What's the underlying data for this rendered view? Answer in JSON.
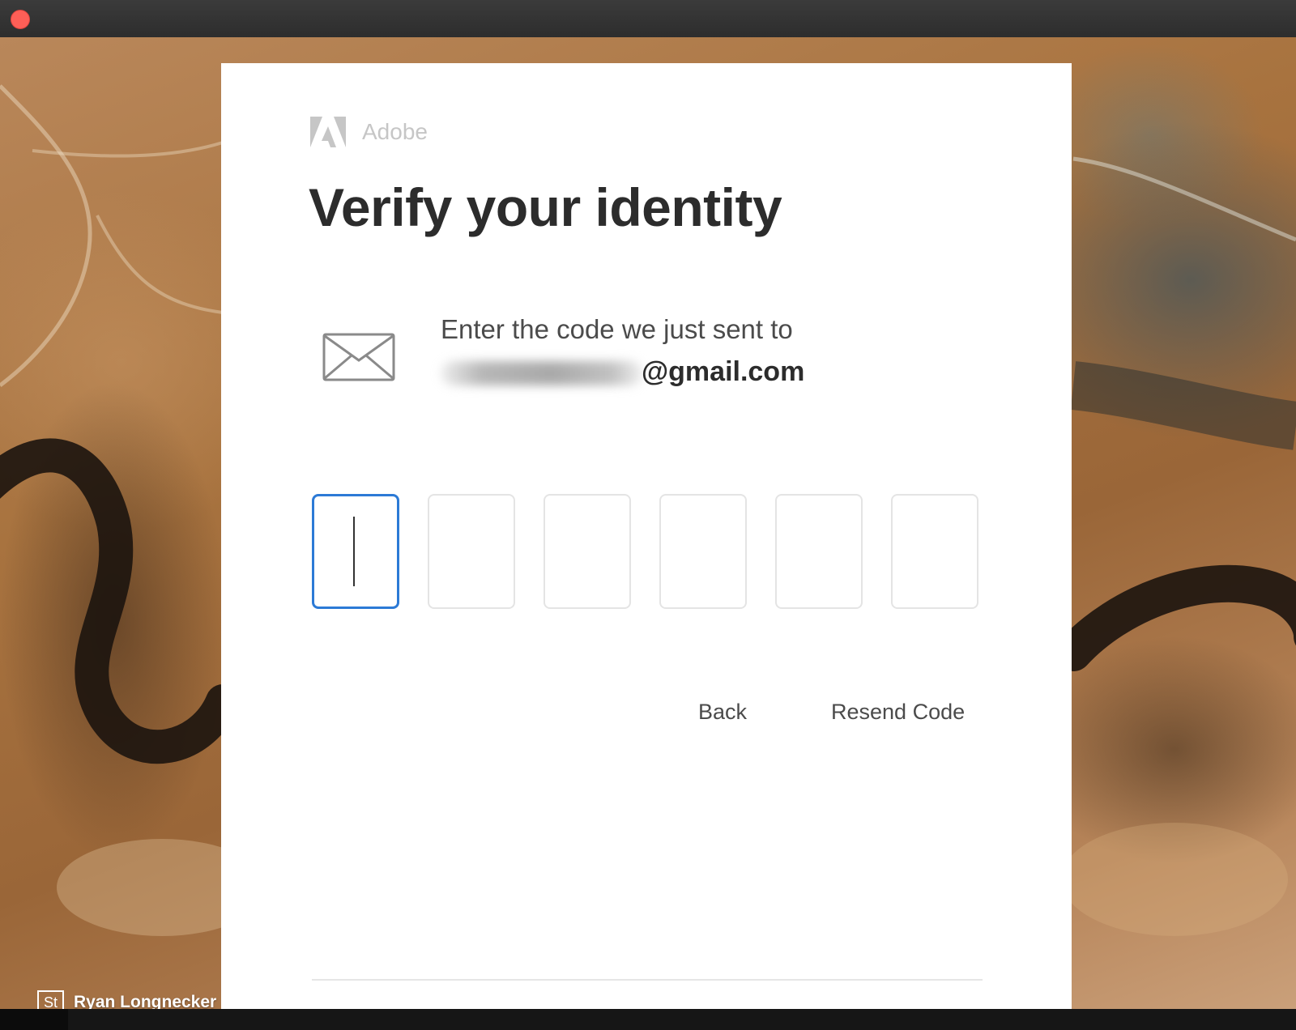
{
  "window": {
    "close_color": "#fe5f57"
  },
  "background": {
    "photo_credit_badge": "St",
    "photo_credit_name": "Ryan Longnecker"
  },
  "brand": {
    "name": "Adobe",
    "logo_icon": "adobe-logo-icon",
    "color": "#c6c6c6"
  },
  "page": {
    "title": "Verify your identity"
  },
  "message": {
    "icon": "mail-icon",
    "instruction": "Enter the code we just sent to",
    "email_visible_part": "@gmail.com",
    "email_local_part_redacted": true
  },
  "code_input": {
    "digits": [
      "",
      "",
      "",
      "",
      "",
      ""
    ],
    "active_index": 0,
    "active_color": "#2c7ad6"
  },
  "actions": {
    "back_label": "Back",
    "resend_label": "Resend Code"
  }
}
